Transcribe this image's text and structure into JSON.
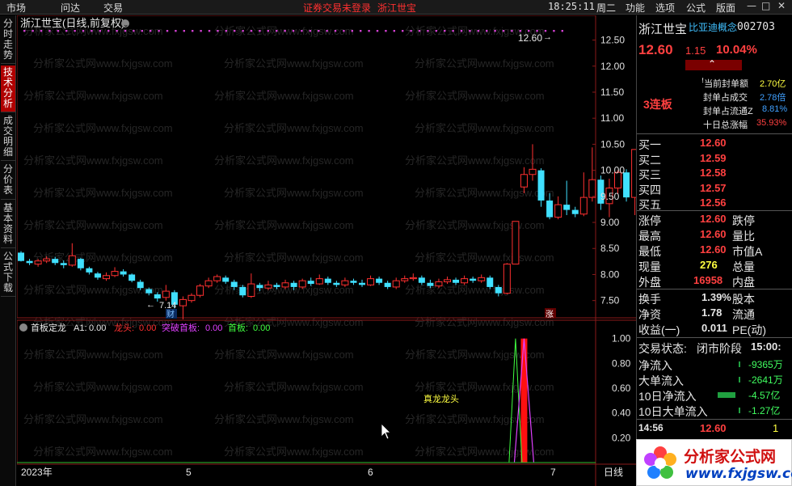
{
  "menu": {
    "items": [
      "市场",
      "问达",
      "交易"
    ],
    "notice": "证券交易未登录",
    "stock_short": "浙江世宝",
    "time": "18:25:11",
    "weekday": "周二",
    "right_items": [
      "功能",
      "选项",
      "公式",
      "版面"
    ]
  },
  "left_tabs": [
    {
      "label": "分时走势",
      "active": false
    },
    {
      "label": "技术分析",
      "active": true
    },
    {
      "label": "成交明细",
      "active": false
    },
    {
      "label": "分价表",
      "active": false
    },
    {
      "label": "基本资料",
      "active": false
    },
    {
      "label": "公式下载",
      "active": false
    }
  ],
  "chart_header": {
    "title": "浙江世宝(日线,前复权)",
    "last_price_label": "12.60",
    "low_label": "7.14",
    "finance_badge": "财",
    "limit_badge": "涨"
  },
  "indicator": {
    "name": "首板定龙",
    "a1_label": "A1:",
    "a1_value": "0.00",
    "items": [
      {
        "label": "龙头:",
        "value": "0.00",
        "color": "#ff3030"
      },
      {
        "label": "突破首板:",
        "value": "0.00",
        "color": "#e040ff"
      },
      {
        "label": "首板:",
        "value": "0.00",
        "color": "#40ff40"
      }
    ],
    "annotation": "真龙龙头"
  },
  "x_axis": {
    "labels": [
      "2023年",
      "5",
      "6",
      "7"
    ],
    "period": "日线"
  },
  "colors": {
    "up": "#ff3030",
    "down": "#40e0ff",
    "bg": "#000000",
    "grid": "#801010"
  },
  "chart_data": [
    {
      "type": "candlestick",
      "title": "浙江世宝(日线,前复权)",
      "ylim": [
        7.2,
        12.85
      ],
      "y_ticks": [
        "12.50",
        "12.00",
        "11.50",
        "11.00",
        "10.50",
        "10.00",
        "9.50",
        "9.00",
        "8.50",
        "8.00",
        "7.50"
      ],
      "candles": [
        [
          8.42,
          8.26,
          8.45,
          8.25
        ],
        [
          8.26,
          8.22,
          8.3,
          8.18
        ],
        [
          8.2,
          8.26,
          8.3,
          8.15
        ],
        [
          8.26,
          8.3,
          8.35,
          8.22
        ],
        [
          8.3,
          8.22,
          8.34,
          8.18
        ],
        [
          8.22,
          8.18,
          8.27,
          8.12
        ],
        [
          8.18,
          8.36,
          8.6,
          8.15
        ],
        [
          8.3,
          8.12,
          8.32,
          8.08
        ],
        [
          8.12,
          8.04,
          8.15,
          8.0
        ],
        [
          8.02,
          7.94,
          8.05,
          7.9
        ],
        [
          7.92,
          7.98,
          8.04,
          7.88
        ],
        [
          7.98,
          8.06,
          8.14,
          7.95
        ],
        [
          8.06,
          8.0,
          8.1,
          7.96
        ],
        [
          8.0,
          7.88,
          8.02,
          7.85
        ],
        [
          7.86,
          7.74,
          7.9,
          7.7
        ],
        [
          7.72,
          7.64,
          7.75,
          7.6
        ],
        [
          7.62,
          7.54,
          7.66,
          7.48
        ],
        [
          7.56,
          7.68,
          7.8,
          7.5
        ],
        [
          7.66,
          7.42,
          7.7,
          7.35
        ],
        [
          7.4,
          7.52,
          7.58,
          7.14
        ],
        [
          7.5,
          7.6,
          7.64,
          7.46
        ],
        [
          7.6,
          7.78,
          7.82,
          7.56
        ],
        [
          7.78,
          7.88,
          7.94,
          7.74
        ],
        [
          7.88,
          7.96,
          8.0,
          7.84
        ],
        [
          7.94,
          7.86,
          7.98,
          7.82
        ],
        [
          7.86,
          7.76,
          7.9,
          7.7
        ],
        [
          7.76,
          7.6,
          7.8,
          7.56
        ],
        [
          7.58,
          7.82,
          8.02,
          7.55
        ],
        [
          7.8,
          7.74,
          7.84,
          7.68
        ],
        [
          7.74,
          7.8,
          7.88,
          7.7
        ],
        [
          7.8,
          7.76,
          7.84,
          7.72
        ],
        [
          7.76,
          7.84,
          7.9,
          7.72
        ],
        [
          7.84,
          7.76,
          7.88,
          7.7
        ],
        [
          7.76,
          7.88,
          7.92,
          7.72
        ],
        [
          7.88,
          7.82,
          7.94,
          7.78
        ],
        [
          7.82,
          7.92,
          8.0,
          7.8
        ],
        [
          7.92,
          7.84,
          7.96,
          7.8
        ],
        [
          7.84,
          7.8,
          7.88,
          7.76
        ],
        [
          7.8,
          7.88,
          7.94,
          7.76
        ],
        [
          7.88,
          7.84,
          7.92,
          7.8
        ],
        [
          7.84,
          7.8,
          7.9,
          7.76
        ],
        [
          7.8,
          7.92,
          7.98,
          7.78
        ],
        [
          7.92,
          7.84,
          7.96,
          7.8
        ],
        [
          7.84,
          7.76,
          7.88,
          7.72
        ],
        [
          7.76,
          7.88,
          7.94,
          7.72
        ],
        [
          7.88,
          7.92,
          7.98,
          7.84
        ],
        [
          7.92,
          7.94,
          8.02,
          7.88
        ],
        [
          7.94,
          7.84,
          7.98,
          7.8
        ],
        [
          7.84,
          7.78,
          7.9,
          7.74
        ],
        [
          7.78,
          7.86,
          7.92,
          7.74
        ],
        [
          7.86,
          7.9,
          7.96,
          7.82
        ],
        [
          7.9,
          7.84,
          7.94,
          7.8
        ],
        [
          7.84,
          7.92,
          7.98,
          7.8
        ],
        [
          7.92,
          7.88,
          7.96,
          7.84
        ],
        [
          7.88,
          7.94,
          8.0,
          7.84
        ],
        [
          7.94,
          7.76,
          7.98,
          7.72
        ],
        [
          7.76,
          7.64,
          7.8,
          7.58
        ],
        [
          7.64,
          8.2,
          8.22,
          7.62
        ],
        [
          8.2,
          9.02,
          9.02,
          8.2
        ],
        [
          9.68,
          9.92,
          10.06,
          9.56
        ],
        [
          9.92,
          10.02,
          10.5,
          9.8
        ],
        [
          10.0,
          9.42,
          10.04,
          9.3
        ],
        [
          9.42,
          9.1,
          9.56,
          9.06
        ],
        [
          9.1,
          9.34,
          9.5,
          9.06
        ],
        [
          9.34,
          9.24,
          9.8,
          9.14
        ],
        [
          9.24,
          9.16,
          9.3,
          9.1
        ],
        [
          9.16,
          9.48,
          9.96,
          9.12
        ],
        [
          9.48,
          9.82,
          10.44,
          9.4
        ],
        [
          9.82,
          9.36,
          9.9,
          9.24
        ],
        [
          9.36,
          9.66,
          9.84,
          9.1
        ],
        [
          9.66,
          9.96,
          10.0,
          9.54
        ],
        [
          9.96,
          9.48,
          10.02,
          9.4
        ],
        [
          9.48,
          10.4,
          10.4,
          9.14
        ],
        [
          10.6,
          11.42,
          11.42,
          10.6
        ]
      ]
    },
    {
      "type": "line",
      "title": "首板定龙",
      "ylim": [
        0,
        1.05
      ],
      "y_ticks": [
        "1.00",
        "0.80",
        "0.60",
        "0.40",
        "0.20"
      ],
      "series": [
        {
          "name": "龙头",
          "peaks": [
            [
              59,
              1
            ]
          ],
          "color": "#ff3030"
        },
        {
          "name": "突破首板",
          "peaks": [
            [
              59,
              1
            ],
            [
              75,
              1
            ]
          ],
          "color": "#e040ff"
        },
        {
          "name": "首板",
          "peaks": [
            [
              58,
              1
            ]
          ],
          "color": "#40ff40"
        }
      ]
    }
  ],
  "quote": {
    "name": "浙江世宝",
    "concept": "比亚迪概念",
    "code": "002703",
    "price": "12.60",
    "change": "1.15",
    "pct": "10.04%",
    "streak": "3连板",
    "stats": [
      {
        "label": "当前封单额",
        "value": "2.70亿",
        "vcolor": "#ffff40"
      },
      {
        "label": "封单占成交",
        "value": "2.78倍",
        "vcolor": "#40a0ff"
      },
      {
        "label": "封单占流通Z",
        "value": "8.81%",
        "vcolor": "#40a0ff"
      },
      {
        "label": "十日总涨幅",
        "value": "35.93%",
        "vcolor": "#ff4040"
      }
    ],
    "bids": [
      {
        "label": "买一",
        "price": "12.60"
      },
      {
        "label": "买二",
        "price": "12.59"
      },
      {
        "label": "买三",
        "price": "12.58"
      },
      {
        "label": "买四",
        "price": "12.57"
      },
      {
        "label": "买五",
        "price": "12.56"
      }
    ],
    "info1": [
      {
        "label": "涨停",
        "value": "12.60",
        "label2": "跌停"
      },
      {
        "label": "最高",
        "value": "12.60",
        "label2": "量比"
      },
      {
        "label": "最低",
        "value": "12.60",
        "label2": "市值A"
      },
      {
        "label": "现量",
        "value": "276",
        "label2": "总量"
      },
      {
        "label": "外盘",
        "value": "16958",
        "label2": "内盘"
      }
    ],
    "info2": [
      {
        "label": "换手",
        "value": "1.39%",
        "label2": "股本"
      },
      {
        "label": "净资",
        "value": "1.78",
        "label2": "流通"
      },
      {
        "label": "收益(一)",
        "value": "0.011",
        "label2": "PE(动)"
      }
    ],
    "status_label": "交易状态:",
    "status_value": "闭市阶段",
    "status_time": "15:00:",
    "flows": [
      {
        "label": "净流入",
        "value": "-9365万"
      },
      {
        "label": "大单流入",
        "value": "-2641万"
      },
      {
        "label": "10日净流入",
        "value": "-4.57亿"
      },
      {
        "label": "10日大单流入",
        "value": "-1.27亿"
      }
    ],
    "tick_time": "14:56",
    "tick_price": "12.60",
    "tick_vol": "1"
  },
  "watermark": {
    "cn": "分析家公式网",
    "url": "www.fxjgsw.com"
  }
}
